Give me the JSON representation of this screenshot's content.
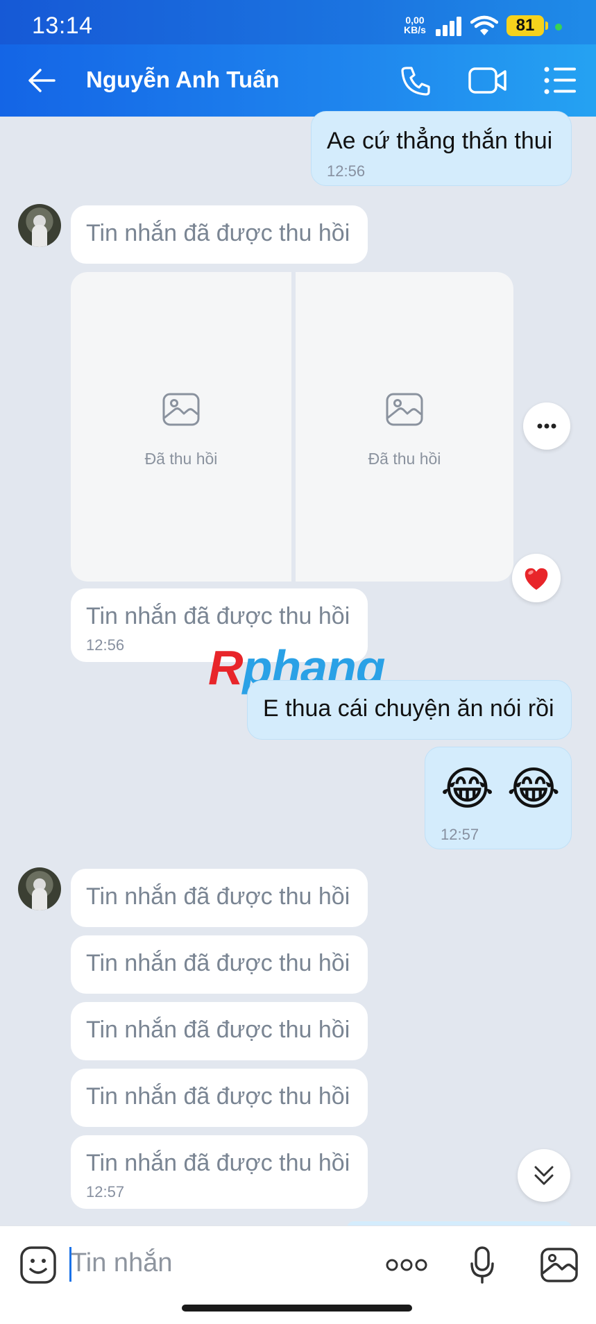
{
  "status_bar": {
    "time": "13:14",
    "net_speed_value": "0,00",
    "net_speed_unit": "KB/s",
    "battery": "81"
  },
  "header": {
    "contact_name": "Nguyễn Anh Tuấn",
    "icons": [
      "back-arrow-icon",
      "phone-icon",
      "video-call-icon",
      "list-menu-icon"
    ]
  },
  "messages": {
    "m1": {
      "text": "Ae cứ thẳng thắn thui",
      "time": "12:56",
      "direction": "out"
    },
    "m2": {
      "text": "Tin nhắn đã được thu hồi",
      "direction": "in"
    },
    "images": {
      "left_label": "Đã thu hồi",
      "right_label": "Đã thu hồi",
      "reaction": "heart"
    },
    "m3": {
      "text": "Tin nhắn đã được thu hồi",
      "time": "12:56",
      "direction": "in"
    },
    "m4": {
      "text": "E thua cái chuyện ăn nói rồi",
      "direction": "out"
    },
    "m5": {
      "emoji": "😂 😂",
      "time": "12:57",
      "direction": "out"
    },
    "m6": {
      "text": "Tin nhắn đã được thu hồi",
      "direction": "in"
    },
    "m7": {
      "text": "Tin nhắn đã được thu hồi",
      "direction": "in"
    },
    "m8": {
      "text": "Tin nhắn đã được thu hồi",
      "direction": "in"
    },
    "m9": {
      "text": "Tin nhắn đã được thu hồi",
      "direction": "in"
    },
    "m10": {
      "text": "Tin nhắn đã được thu hồi",
      "time": "12:57",
      "direction": "in"
    }
  },
  "watermark": {
    "first": "R",
    "rest": "phang"
  },
  "input": {
    "placeholder": "Tin nhắn"
  },
  "colors": {
    "header": "#1f86ee",
    "outgoing_bubble": "#d4ecfc",
    "incoming_bubble": "#ffffff",
    "chat_bg": "#e2e7ef",
    "heart": "#e8252a"
  }
}
